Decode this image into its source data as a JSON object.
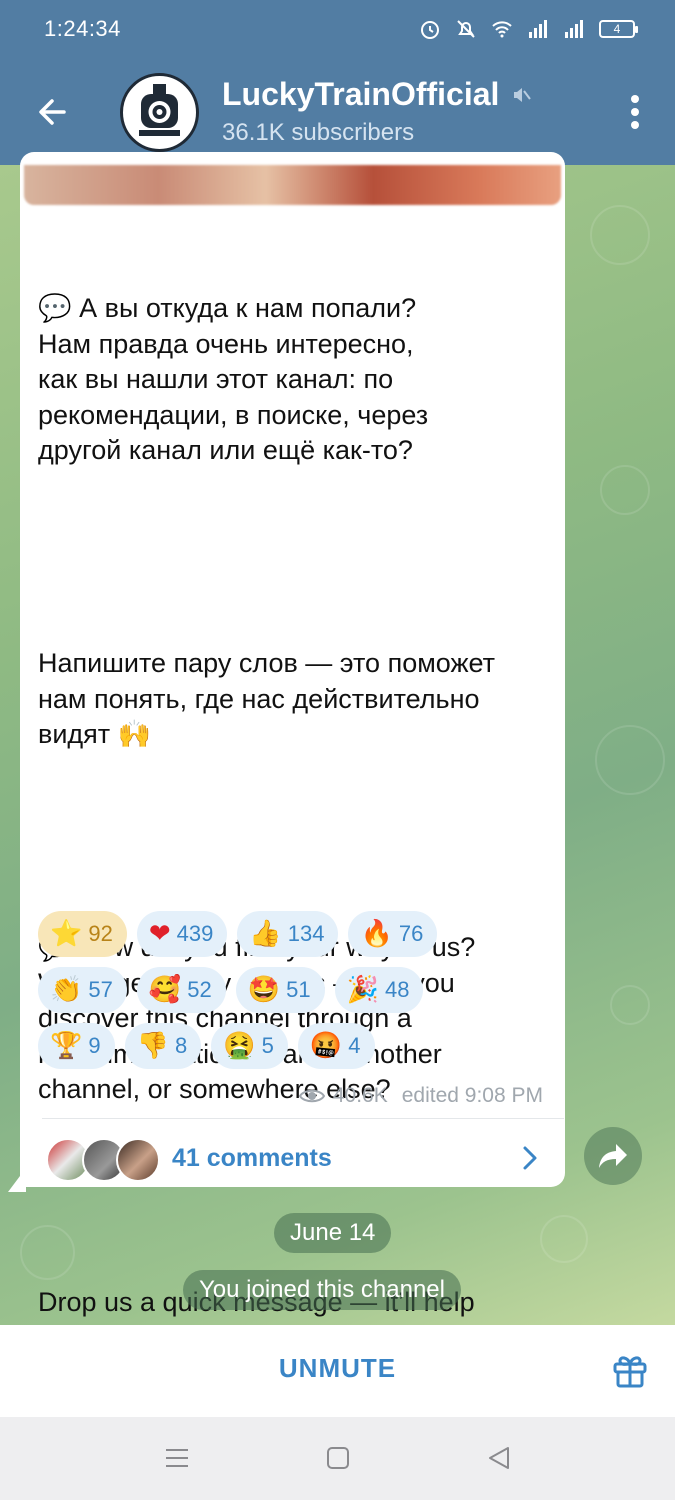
{
  "status_bar": {
    "time": "1:24:34",
    "battery": "4"
  },
  "header": {
    "channel_name": "LuckyTrainOfficial",
    "subscribers": "36.1K subscribers",
    "icons": [
      "back-arrow-icon",
      "muted-speaker-icon",
      "more-vertical-icon"
    ]
  },
  "message": {
    "paragraphs": [
      "💬 А вы откуда к нам попали?\nНам правда очень интересно,\nкак вы нашли этот канал: по\nрекомендации, в поиске, через\nдругой канал или ещё как-то?",
      "Напишите пару слов — это поможет\nнам понять, где нас действительно\nвидят 🙌",
      "💬 How did you find your way to us?\nWe’re genuinely curious — did you\ndiscover this channel through a\nrecommendation, search, another\nchannel, or somewhere else?",
      "Drop us a quick message — it’ll help\nus understand where people are\nactually finding us 🙌"
    ],
    "reactions": [
      [
        {
          "emoji": "⭐",
          "count": "92"
        },
        {
          "emoji": "❤",
          "count": "439"
        },
        {
          "emoji": "👍",
          "count": "134"
        },
        {
          "emoji": "🔥",
          "count": "76"
        }
      ],
      [
        {
          "emoji": "👏",
          "count": "57"
        },
        {
          "emoji": "🥰",
          "count": "52"
        },
        {
          "emoji": "🤩",
          "count": "51"
        },
        {
          "emoji": "🎉",
          "count": "48"
        }
      ],
      [
        {
          "emoji": "🏆",
          "count": "9"
        },
        {
          "emoji": "👎",
          "count": "8"
        },
        {
          "emoji": "🤮",
          "count": "5"
        },
        {
          "emoji": "🤬",
          "count": "4"
        }
      ]
    ],
    "views": "40.6K",
    "edited": "edited 9:08 PM",
    "comments_label": "41 comments"
  },
  "service": {
    "date": "June 14",
    "joined": "You joined this channel"
  },
  "bottom": {
    "unmute": "UNMUTE"
  },
  "colors": {
    "header": "#527da3",
    "accent": "#3a85c6",
    "paid_reaction": "#f8e6b8",
    "reaction_bg": "#e4f0fa"
  }
}
